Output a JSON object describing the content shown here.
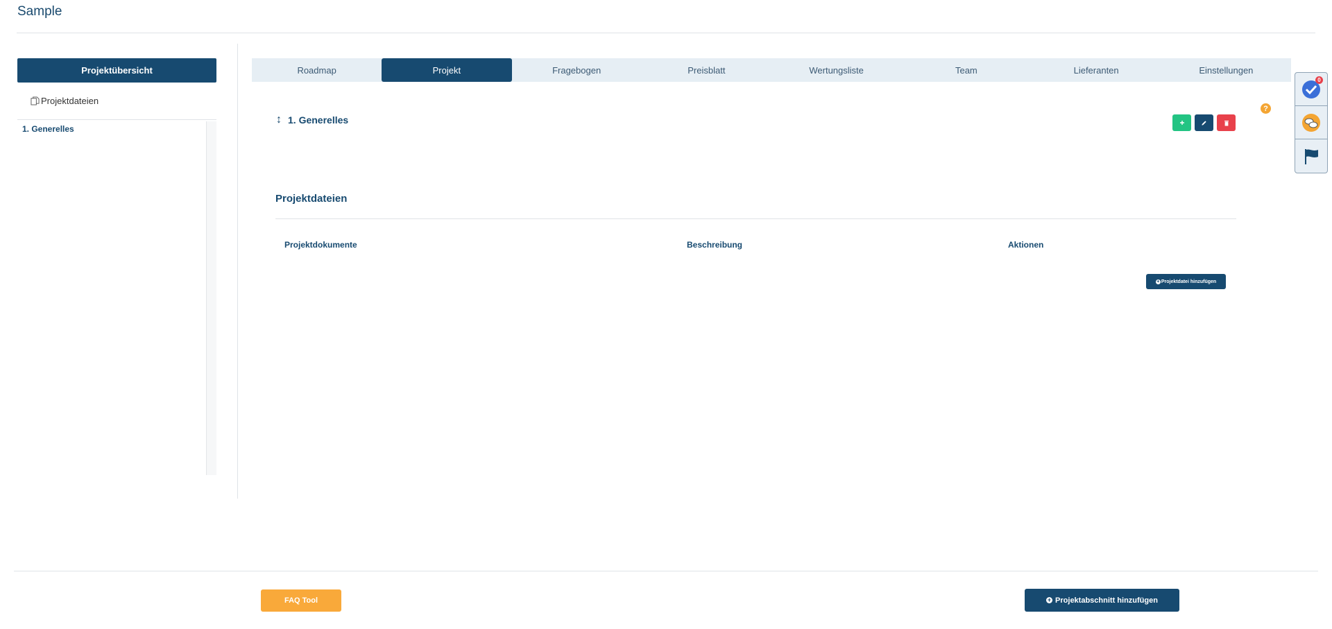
{
  "app": {
    "title": "Sample"
  },
  "sidebar": {
    "header": "Projektübersicht",
    "files_label": "Projektdateien",
    "tree": [
      {
        "label": "1. Generelles"
      }
    ]
  },
  "tabs": [
    {
      "label": "Roadmap",
      "active": false
    },
    {
      "label": "Projekt",
      "active": true
    },
    {
      "label": "Fragebogen",
      "active": false
    },
    {
      "label": "Preisblatt",
      "active": false
    },
    {
      "label": "Wertungsliste",
      "active": false
    },
    {
      "label": "Team",
      "active": false
    },
    {
      "label": "Lieferanten",
      "active": false
    },
    {
      "label": "Einstellungen",
      "active": false
    }
  ],
  "section": {
    "title": "1. Generelles"
  },
  "help": {
    "glyph": "?"
  },
  "files": {
    "title": "Projektdateien",
    "columns": [
      "Projektdokumente",
      "Beschreibung",
      "Aktionen"
    ],
    "add_button": "Projektdatei hinzufügen"
  },
  "widgets": {
    "badge_count": "0"
  },
  "footer": {
    "faq_button": "FAQ Tool",
    "add_section_button": "Projektabschnitt hinzufügen"
  },
  "colors": {
    "primary": "#174a70",
    "success": "#23c483",
    "danger": "#e8414b",
    "warning": "#f9a93a",
    "tab_bar": "#e6eef4"
  }
}
